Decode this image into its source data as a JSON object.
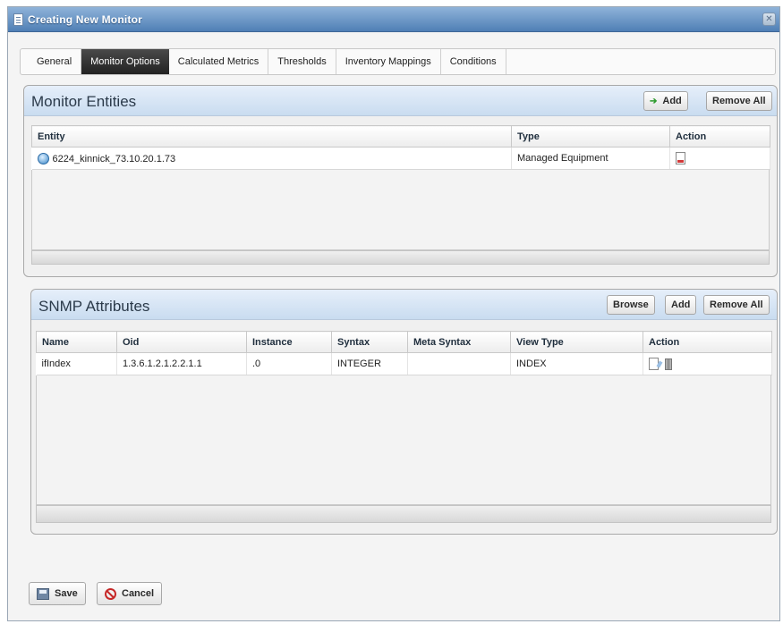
{
  "window": {
    "title": "Creating New Monitor",
    "close_glyph": "✕"
  },
  "tabs": [
    {
      "label": "General"
    },
    {
      "label": "Monitor Options"
    },
    {
      "label": "Calculated Metrics"
    },
    {
      "label": "Thresholds"
    },
    {
      "label": "Inventory Mappings"
    },
    {
      "label": "Conditions"
    }
  ],
  "monitor_entities": {
    "title": "Monitor Entities",
    "add_label": "Add",
    "remove_all_label": "Remove All",
    "columns": [
      "Entity",
      "Type",
      "Action"
    ],
    "rows": [
      {
        "entity": "6224_kinnick_73.10.20.1.73",
        "type": "Managed Equipment"
      }
    ]
  },
  "snmp_attributes": {
    "title": "SNMP Attributes",
    "browse_label": "Browse",
    "add_label": "Add",
    "remove_all_label": "Remove All",
    "columns": [
      "Name",
      "Oid",
      "Instance",
      "Syntax",
      "Meta Syntax",
      "View Type",
      "Action"
    ],
    "rows": [
      {
        "name": "ifIndex",
        "oid": "1.3.6.1.2.1.2.2.1.1",
        "instance": ".0",
        "syntax": "INTEGER",
        "meta_syntax": "",
        "view_type": "INDEX"
      }
    ]
  },
  "footer": {
    "save_label": "Save",
    "cancel_label": "Cancel"
  },
  "icons": {
    "title": "document-icon",
    "entity": "network-device-icon",
    "delete": "delete-document-icon",
    "edit": "edit-document-icon",
    "trash": "trash-icon",
    "save": "floppy-disk-icon",
    "cancel": "cancel-circle-icon"
  },
  "colors": {
    "active_tab": "#2b2b2b",
    "header_gradient": "#c9dcf0",
    "add_plus": "#2d9b2d",
    "cancel_red": "#c62828"
  }
}
